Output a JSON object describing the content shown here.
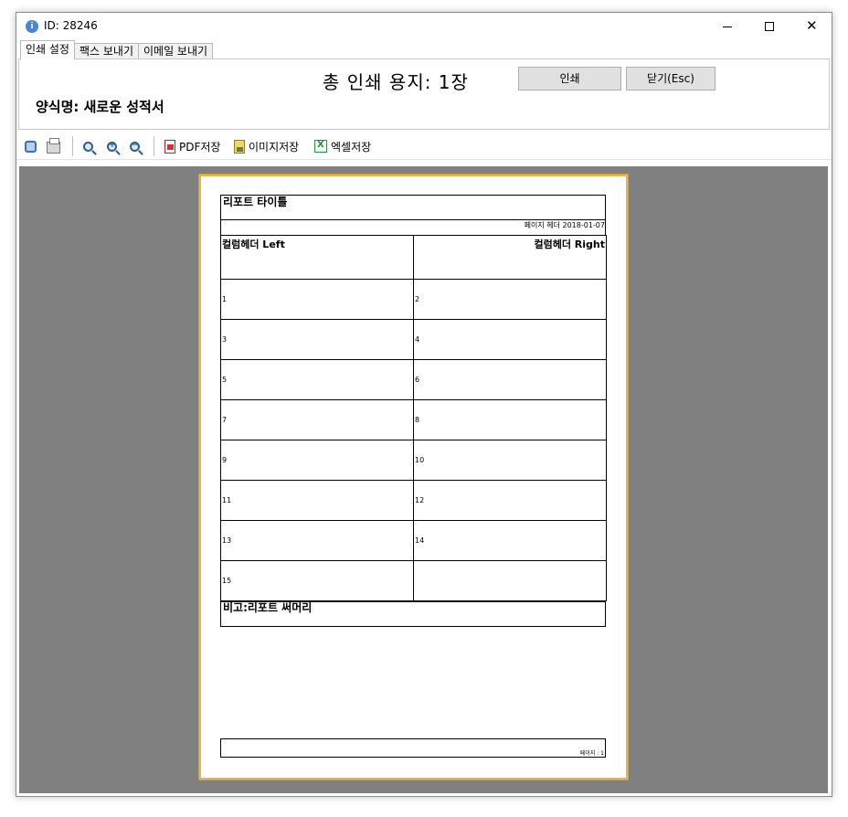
{
  "window": {
    "title": "ID: 28246",
    "controls": {
      "minimize": "—",
      "maximize": "",
      "close": "✕"
    }
  },
  "tabs": [
    {
      "label": "인쇄 설정",
      "active": true
    },
    {
      "label": "팩스 보내기",
      "active": false
    },
    {
      "label": "이메일 보내기",
      "active": false
    }
  ],
  "print_panel": {
    "total_pages": "총 인쇄 용지: 1장",
    "print_button": "인쇄",
    "close_button": "닫기(Esc)",
    "form_name": "양식명: 새로운 성적서"
  },
  "toolbar": {
    "items": [
      {
        "name": "fit-page-icon"
      },
      {
        "name": "print-icon"
      },
      {
        "name": "zoom-icon"
      },
      {
        "name": "zoom-in-icon"
      },
      {
        "name": "zoom-out-icon"
      },
      {
        "name": "pdf-save",
        "label": "PDF저장"
      },
      {
        "name": "image-save",
        "label": "이미지저장"
      },
      {
        "name": "excel-save",
        "label": "엑셀저장"
      }
    ]
  },
  "report": {
    "title": "리포트 타이틀",
    "page_header": "페이지 헤더 2018-01-07",
    "column_header_left": "컬럼헤더 Left",
    "column_header_right": "컬럼헤더 Right",
    "rows": [
      [
        "1",
        "2"
      ],
      [
        "3",
        "4"
      ],
      [
        "5",
        "6"
      ],
      [
        "7",
        "8"
      ],
      [
        "9",
        "10"
      ],
      [
        "11",
        "12"
      ],
      [
        "13",
        "14"
      ],
      [
        "15",
        ""
      ]
    ],
    "summary": "비고:리포트 써머리",
    "footer": "페이지 : 1"
  },
  "colors": {
    "preview_background": "#808080",
    "page_border": "#e8b64a",
    "button_face": "#e1e1e1"
  }
}
